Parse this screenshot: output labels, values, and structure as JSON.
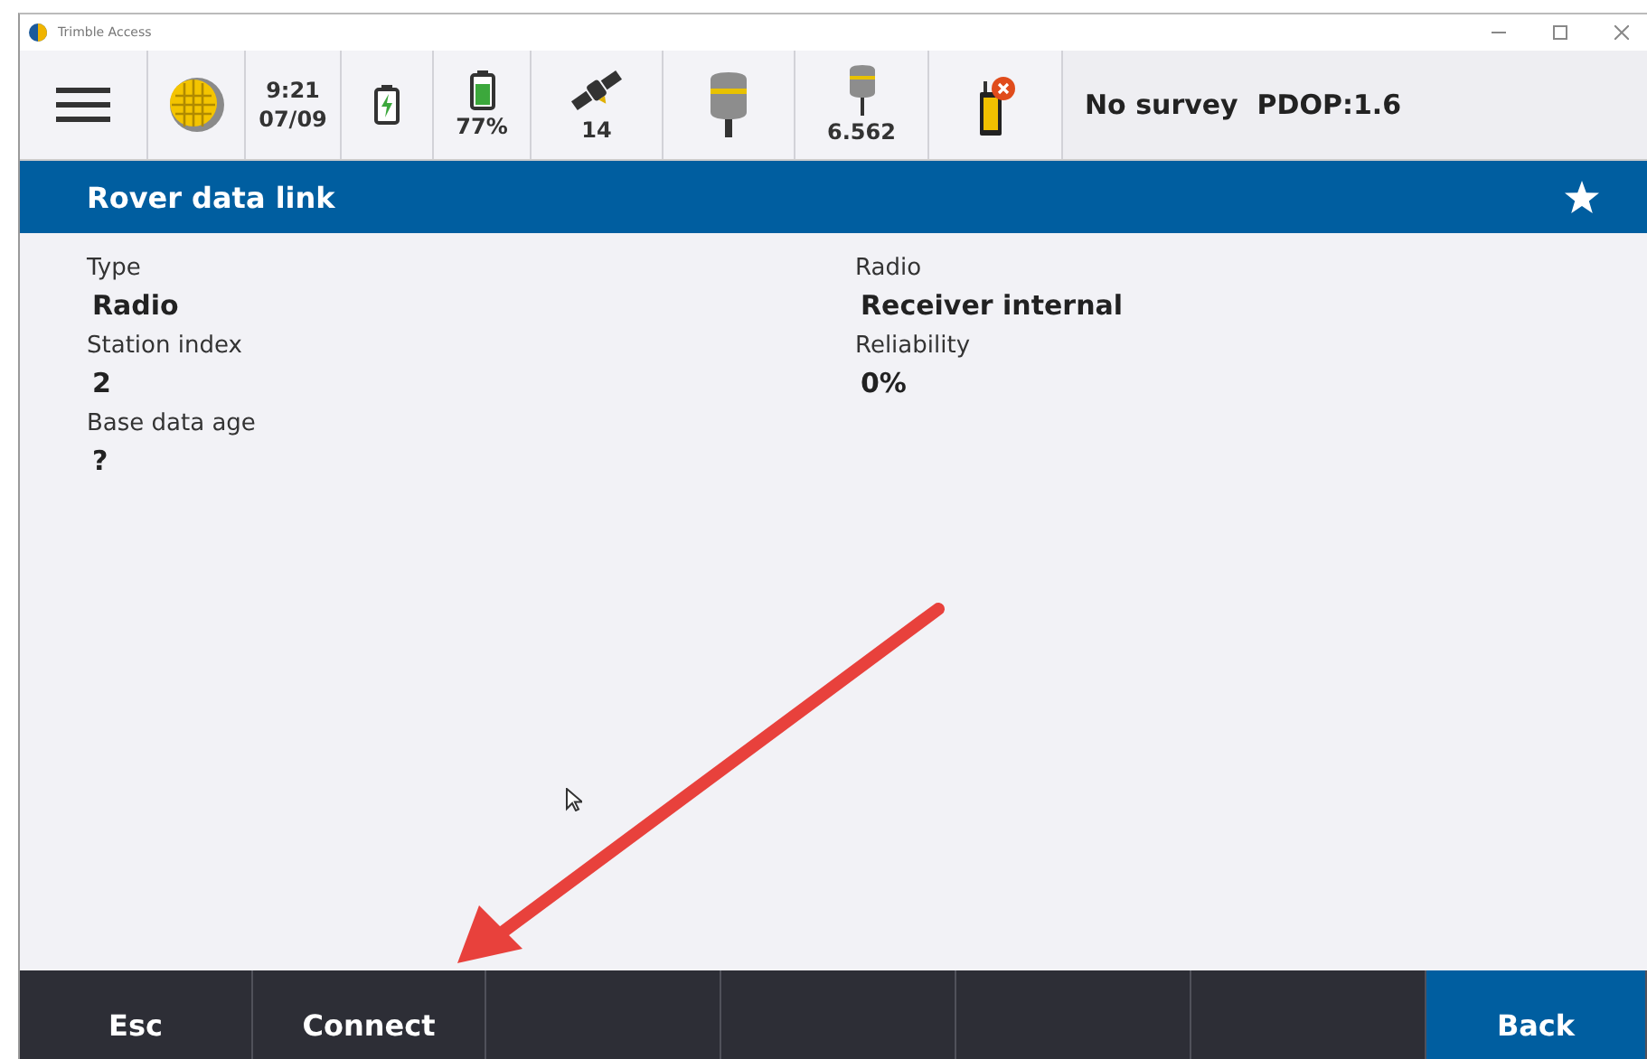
{
  "window": {
    "title": "Trimble Access"
  },
  "status_bar": [
    {
      "kind": "menu"
    },
    {
      "kind": "globe"
    },
    {
      "kind": "clock",
      "time": "9:21",
      "date": "07/09"
    },
    {
      "kind": "charging"
    },
    {
      "kind": "battery",
      "reading": "77%"
    },
    {
      "kind": "satellites",
      "reading": "14"
    },
    {
      "kind": "receiver"
    },
    {
      "kind": "antenna",
      "reading": "6.562"
    },
    {
      "kind": "controller"
    },
    {
      "kind": "text",
      "text": "No survey  PDOP:1.6"
    }
  ],
  "header": {
    "title": "Rover data link"
  },
  "fields": [
    {
      "label": "Type",
      "value": "Radio"
    },
    {
      "label": "Radio",
      "value": "Receiver internal"
    },
    {
      "label": "Station index",
      "value": "2"
    },
    {
      "label": "Reliability",
      "value": "0%"
    },
    {
      "label": "Base data age",
      "value": "?"
    }
  ],
  "softkeys": [
    {
      "kind": "key",
      "label": "Esc",
      "primary": false
    },
    {
      "kind": "key",
      "label": "Connect",
      "primary": false
    },
    {
      "kind": "empty"
    },
    {
      "kind": "empty"
    },
    {
      "kind": "empty"
    },
    {
      "kind": "empty"
    },
    {
      "kind": "key",
      "label": "Back",
      "primary": true
    }
  ]
}
